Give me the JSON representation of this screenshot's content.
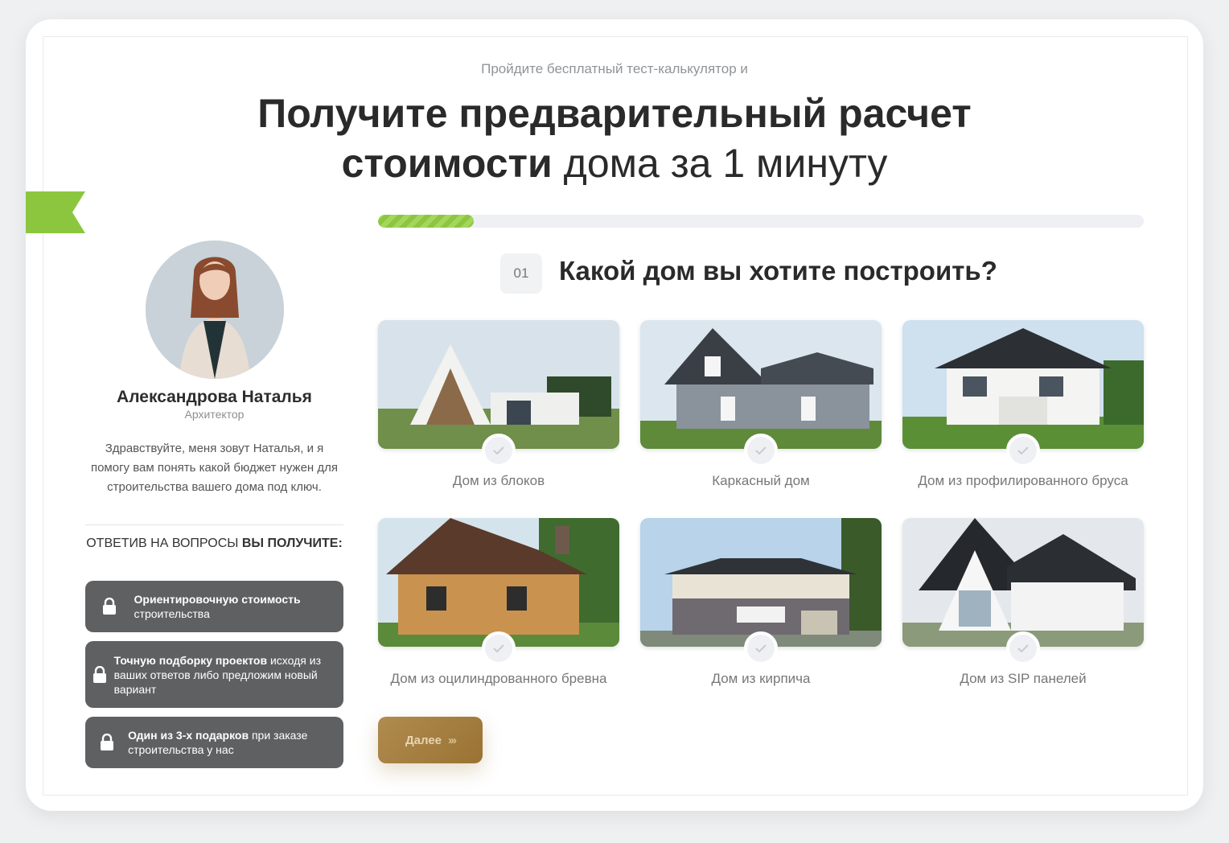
{
  "header": {
    "subtitle": "Пройдите бесплатный тест-калькулятор и",
    "title_bold_1": "Получите предварительный расчет",
    "title_bold_2": "стоимости",
    "title_light": "дома за 1 минуту"
  },
  "progress": {
    "value_fraction": 0.125
  },
  "step": {
    "number": "01",
    "question": "Какой дом вы хотите построить?"
  },
  "consultant": {
    "name": "Александрова Наталья",
    "role": "Архитектор",
    "intro": "Здравствуйте, меня зовут Наталья, и я помогу вам понять какой бюджет нужен для строительства вашего дома под ключ."
  },
  "bonuses": {
    "heading_normal": "Ответив на вопросы",
    "heading_bold": "вы получите:",
    "items": [
      {
        "bold": "Ориентировочную стоимость",
        "normal": " строительства"
      },
      {
        "bold": "Точную подборку проектов",
        "normal": " исходя из ваших ответов либо предложим новый вариант"
      },
      {
        "bold": "Один из 3-х подарков",
        "normal": " при заказе строительства у нас"
      }
    ]
  },
  "options": [
    {
      "label": "Дом из блоков",
      "image": "modern-gable-house"
    },
    {
      "label": "Каркасный дом",
      "image": "grey-frame-house"
    },
    {
      "label": "Дом из профилированного бруса",
      "image": "white-timber-house"
    },
    {
      "label": "Дом из оцилиндрованного бревна",
      "image": "log-house"
    },
    {
      "label": "Дом из кирпича",
      "image": "brick-house"
    },
    {
      "label": "Дом из SIP панелей",
      "image": "white-sip-house"
    }
  ],
  "actions": {
    "next_label": "Далее",
    "next_arrows": "›››"
  },
  "colors": {
    "accent_green": "#8cc63f",
    "button_gold": "#a88143",
    "bonus_bg": "#5f6062"
  }
}
